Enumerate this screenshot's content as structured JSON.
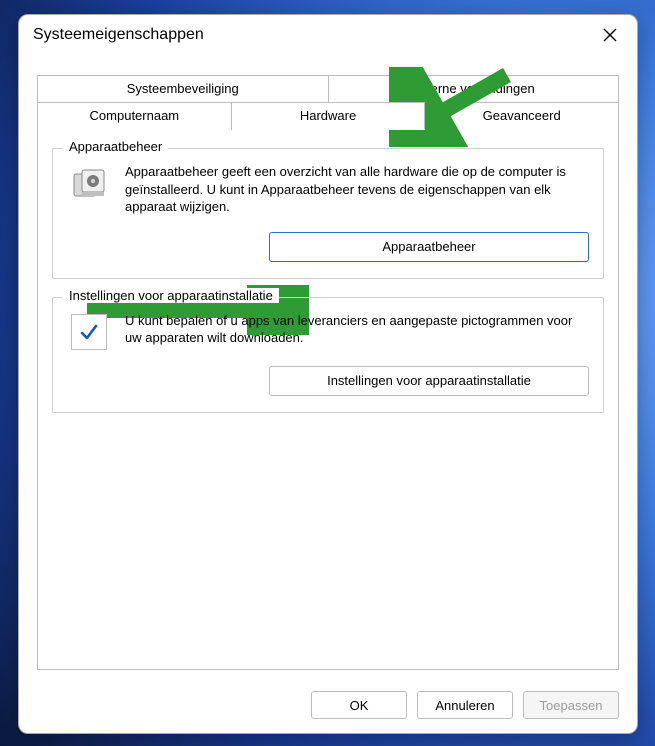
{
  "window": {
    "title": "Systeemeigenschappen"
  },
  "tabs": {
    "top": [
      {
        "label": "Systeembeveiliging"
      },
      {
        "label": "Externe verbindingen"
      }
    ],
    "bottom": [
      {
        "label": "Computernaam"
      },
      {
        "label": "Hardware",
        "active": true
      },
      {
        "label": "Geavanceerd"
      }
    ]
  },
  "group_device_manager": {
    "legend": "Apparaatbeheer",
    "description": "Apparaatbeheer geeft een overzicht van alle hardware die op de computer is geïnstalleerd. U kunt in Apparaatbeheer tevens de eigenschappen van elk apparaat wijzigen.",
    "button": "Apparaatbeheer"
  },
  "group_install_settings": {
    "legend": "Instellingen voor apparaatinstallatie",
    "description": "U kunt bepalen of u apps van leveranciers en aangepaste pictogrammen voor uw apparaten wilt downloaden.",
    "button": "Instellingen voor apparaatinstallatie"
  },
  "buttons": {
    "ok": "OK",
    "cancel": "Annuleren",
    "apply": "Toepassen"
  },
  "annotation": {
    "color": "#2e9b34"
  }
}
